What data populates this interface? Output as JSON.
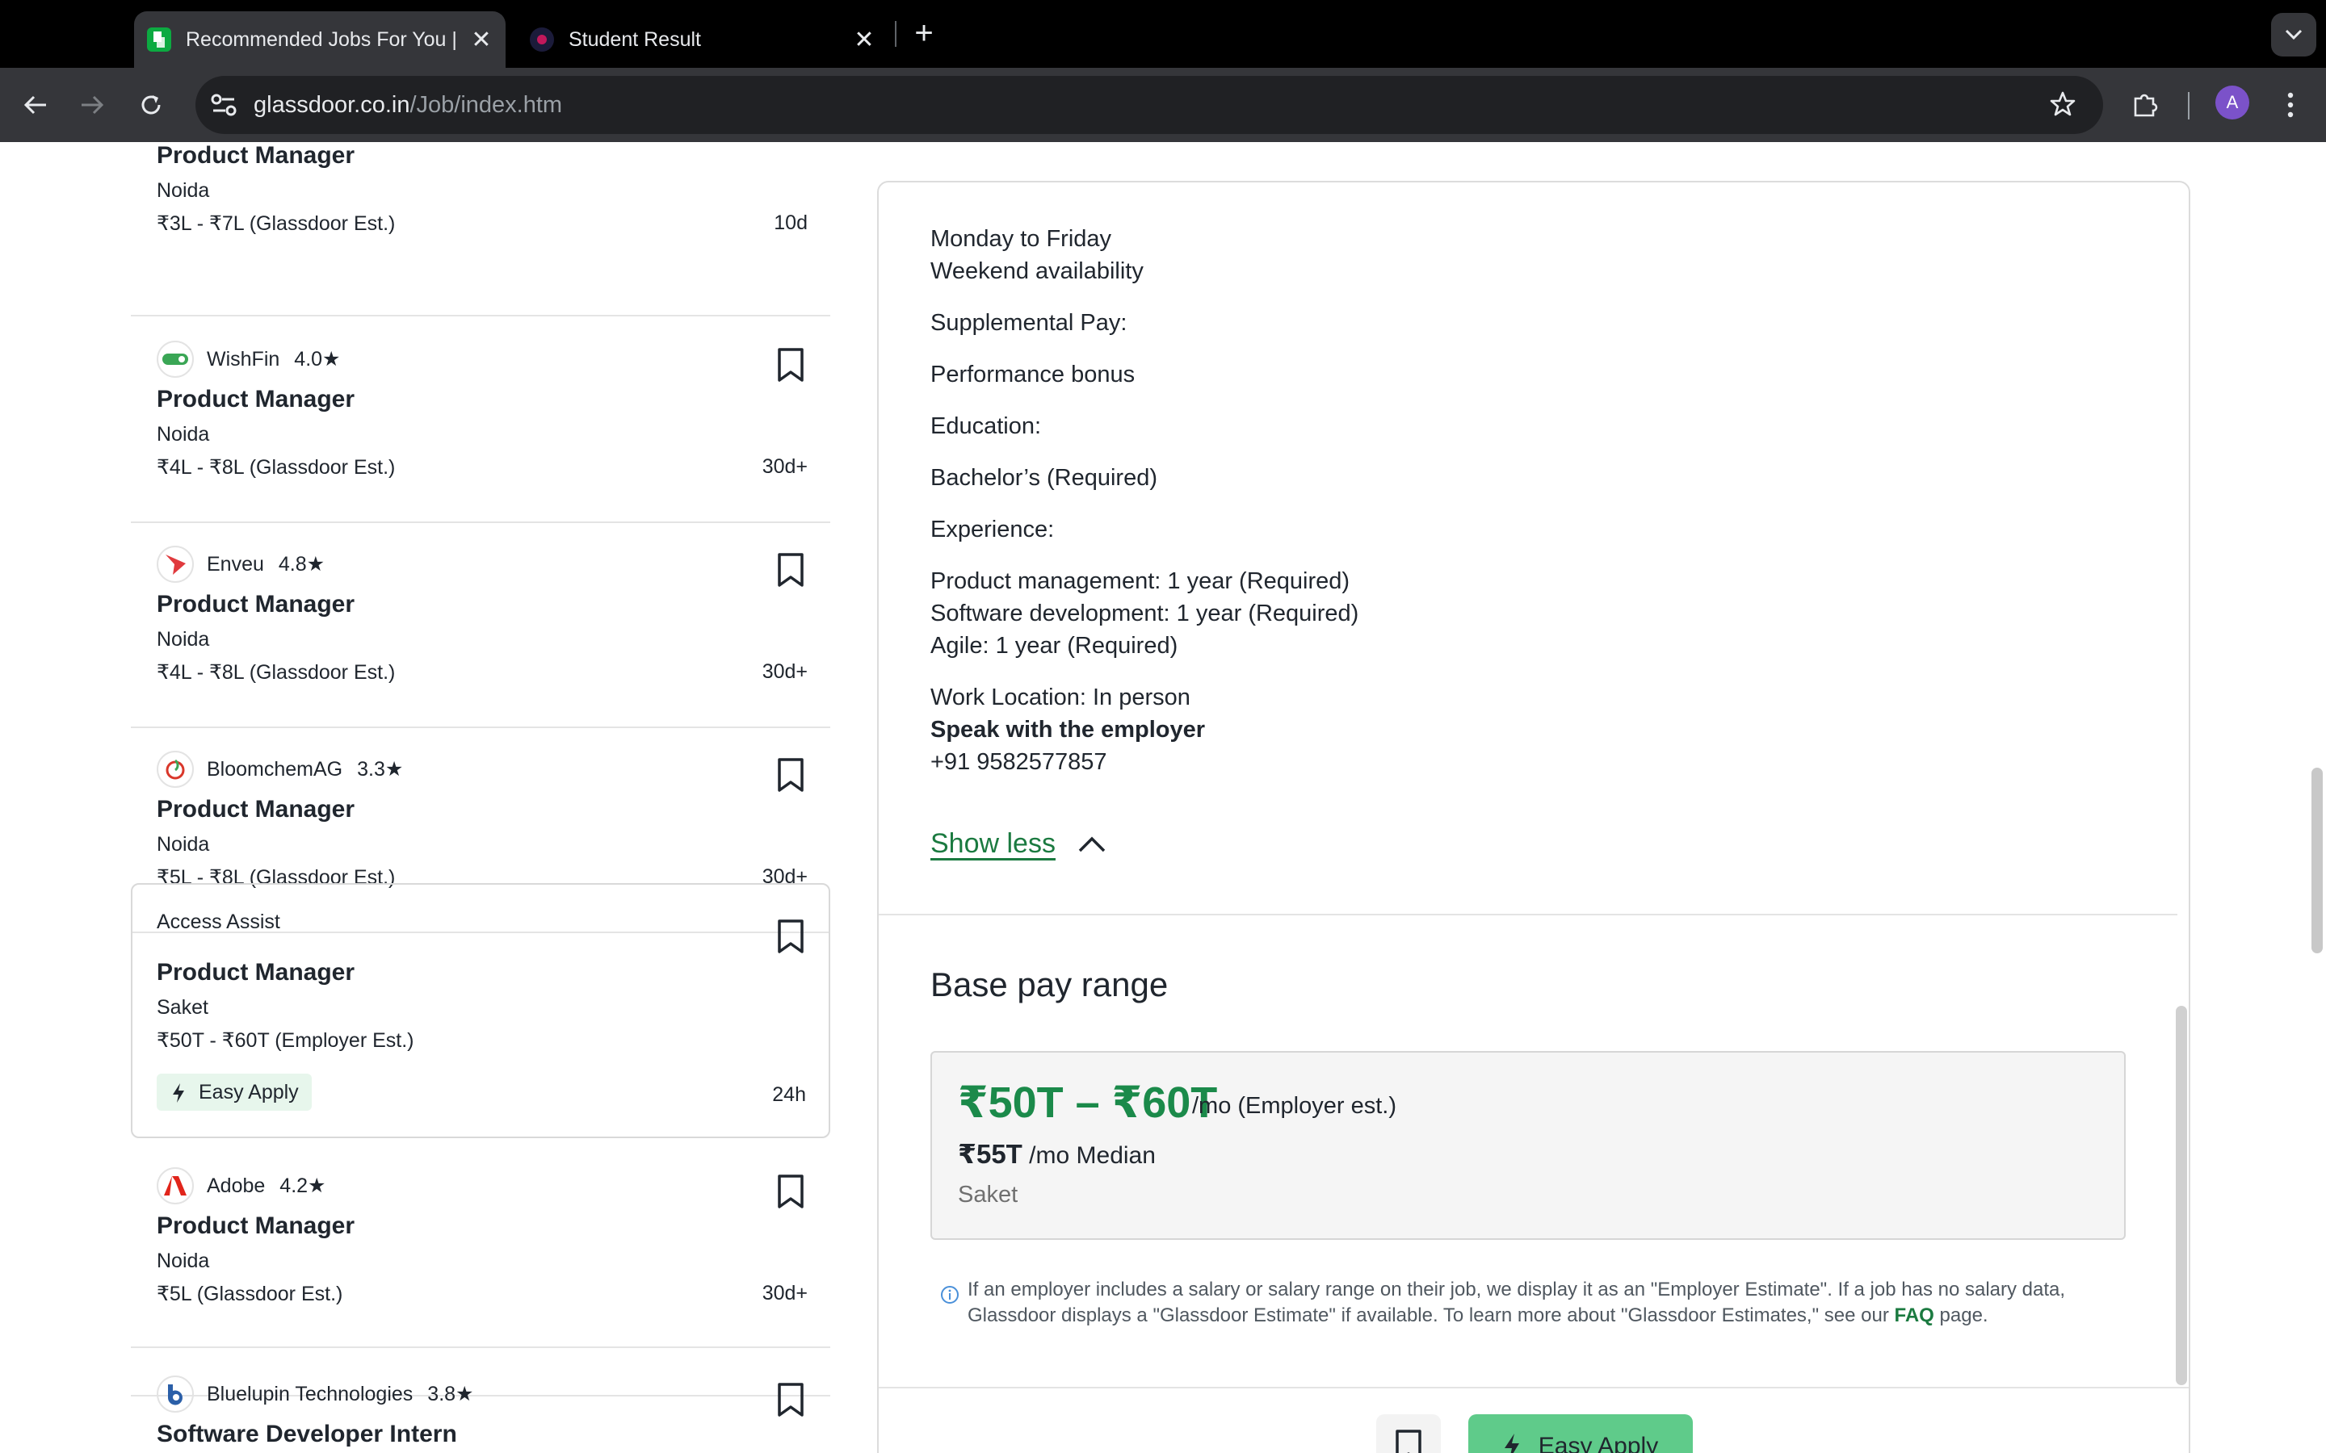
{
  "browser": {
    "tabs": [
      {
        "title": "Recommended Jobs For You |"
      },
      {
        "title": "Student Result"
      }
    ],
    "url_domain": "glassdoor.co.in",
    "url_path": "/Job/index.htm",
    "avatar_letter": "A"
  },
  "job_list": [
    {
      "employer": "",
      "rating": "",
      "title": "Product Manager",
      "location": "Noida",
      "salary": "₹3L - ₹7L (Glassdoor Est.)",
      "age": "10d",
      "logo_color": "#ffffff"
    },
    {
      "employer": "WishFin",
      "rating": "4.0★",
      "title": "Product Manager",
      "location": "Noida",
      "salary": "₹4L - ₹8L (Glassdoor Est.)",
      "age": "30d+",
      "logo_color": "#3aa655"
    },
    {
      "employer": "Enveu",
      "rating": "4.8★",
      "title": "Product Manager",
      "location": "Noida",
      "salary": "₹4L - ₹8L (Glassdoor Est.)",
      "age": "30d+",
      "logo_color": "#e03a3e"
    },
    {
      "employer": "BloomchemAG",
      "rating": "3.3★",
      "title": "Product Manager",
      "location": "Noida",
      "salary": "₹5L - ₹8L (Glassdoor Est.)",
      "age": "30d+",
      "logo_color": "#d9372a"
    },
    {
      "employer": "Access Assist",
      "rating": "",
      "title": "Product Manager",
      "location": "Saket",
      "salary": "₹50T - ₹60T (Employer Est.)",
      "age": "24h",
      "easy_apply": "Easy Apply"
    },
    {
      "employer": "Adobe",
      "rating": "4.2★",
      "title": "Product Manager",
      "location": "Noida",
      "salary": "₹5L (Glassdoor Est.)",
      "age": "30d+",
      "logo_color": "#e1251b"
    },
    {
      "employer": "Bluelupin Technologies",
      "rating": "3.8★",
      "title": "Software Developer Intern",
      "logo_color": "#2b5fa8"
    }
  ],
  "detail": {
    "schedule_1": "Monday to Friday",
    "schedule_2": "Weekend availability",
    "supplemental_heading": "Supplemental Pay:",
    "supplemental_value": "Performance bonus",
    "education_heading": "Education:",
    "education_value": "Bachelor’s (Required)",
    "experience_heading": "Experience:",
    "experience_1": "Product management: 1 year (Required)",
    "experience_2": "Software development: 1 year (Required)",
    "experience_3": "Agile: 1 year (Required)",
    "work_location": "Work Location: In person",
    "speak_heading": "Speak with the employer",
    "phone": "+91 9582577857",
    "show_less": "Show less",
    "base_pay_title": "Base pay range",
    "pay_range": "₹50T – ₹60T",
    "pay_unit": "/mo (Employer est.)",
    "median_value": "₹55T",
    "median_label": "/mo Median",
    "pay_location": "Saket",
    "disclaimer_text": "If an employer includes a salary or salary range on their job, we display it as an \"Employer Estimate\". If a job has no salary data, Glassdoor displays a \"Glassdoor Estimate\" if available. To learn more about \"Glassdoor Estimates,\" see our",
    "faq_link": "FAQ",
    "disclaimer_end": "page.",
    "apply_label": "Easy Apply",
    "accent_color": "#1b8a4a"
  }
}
